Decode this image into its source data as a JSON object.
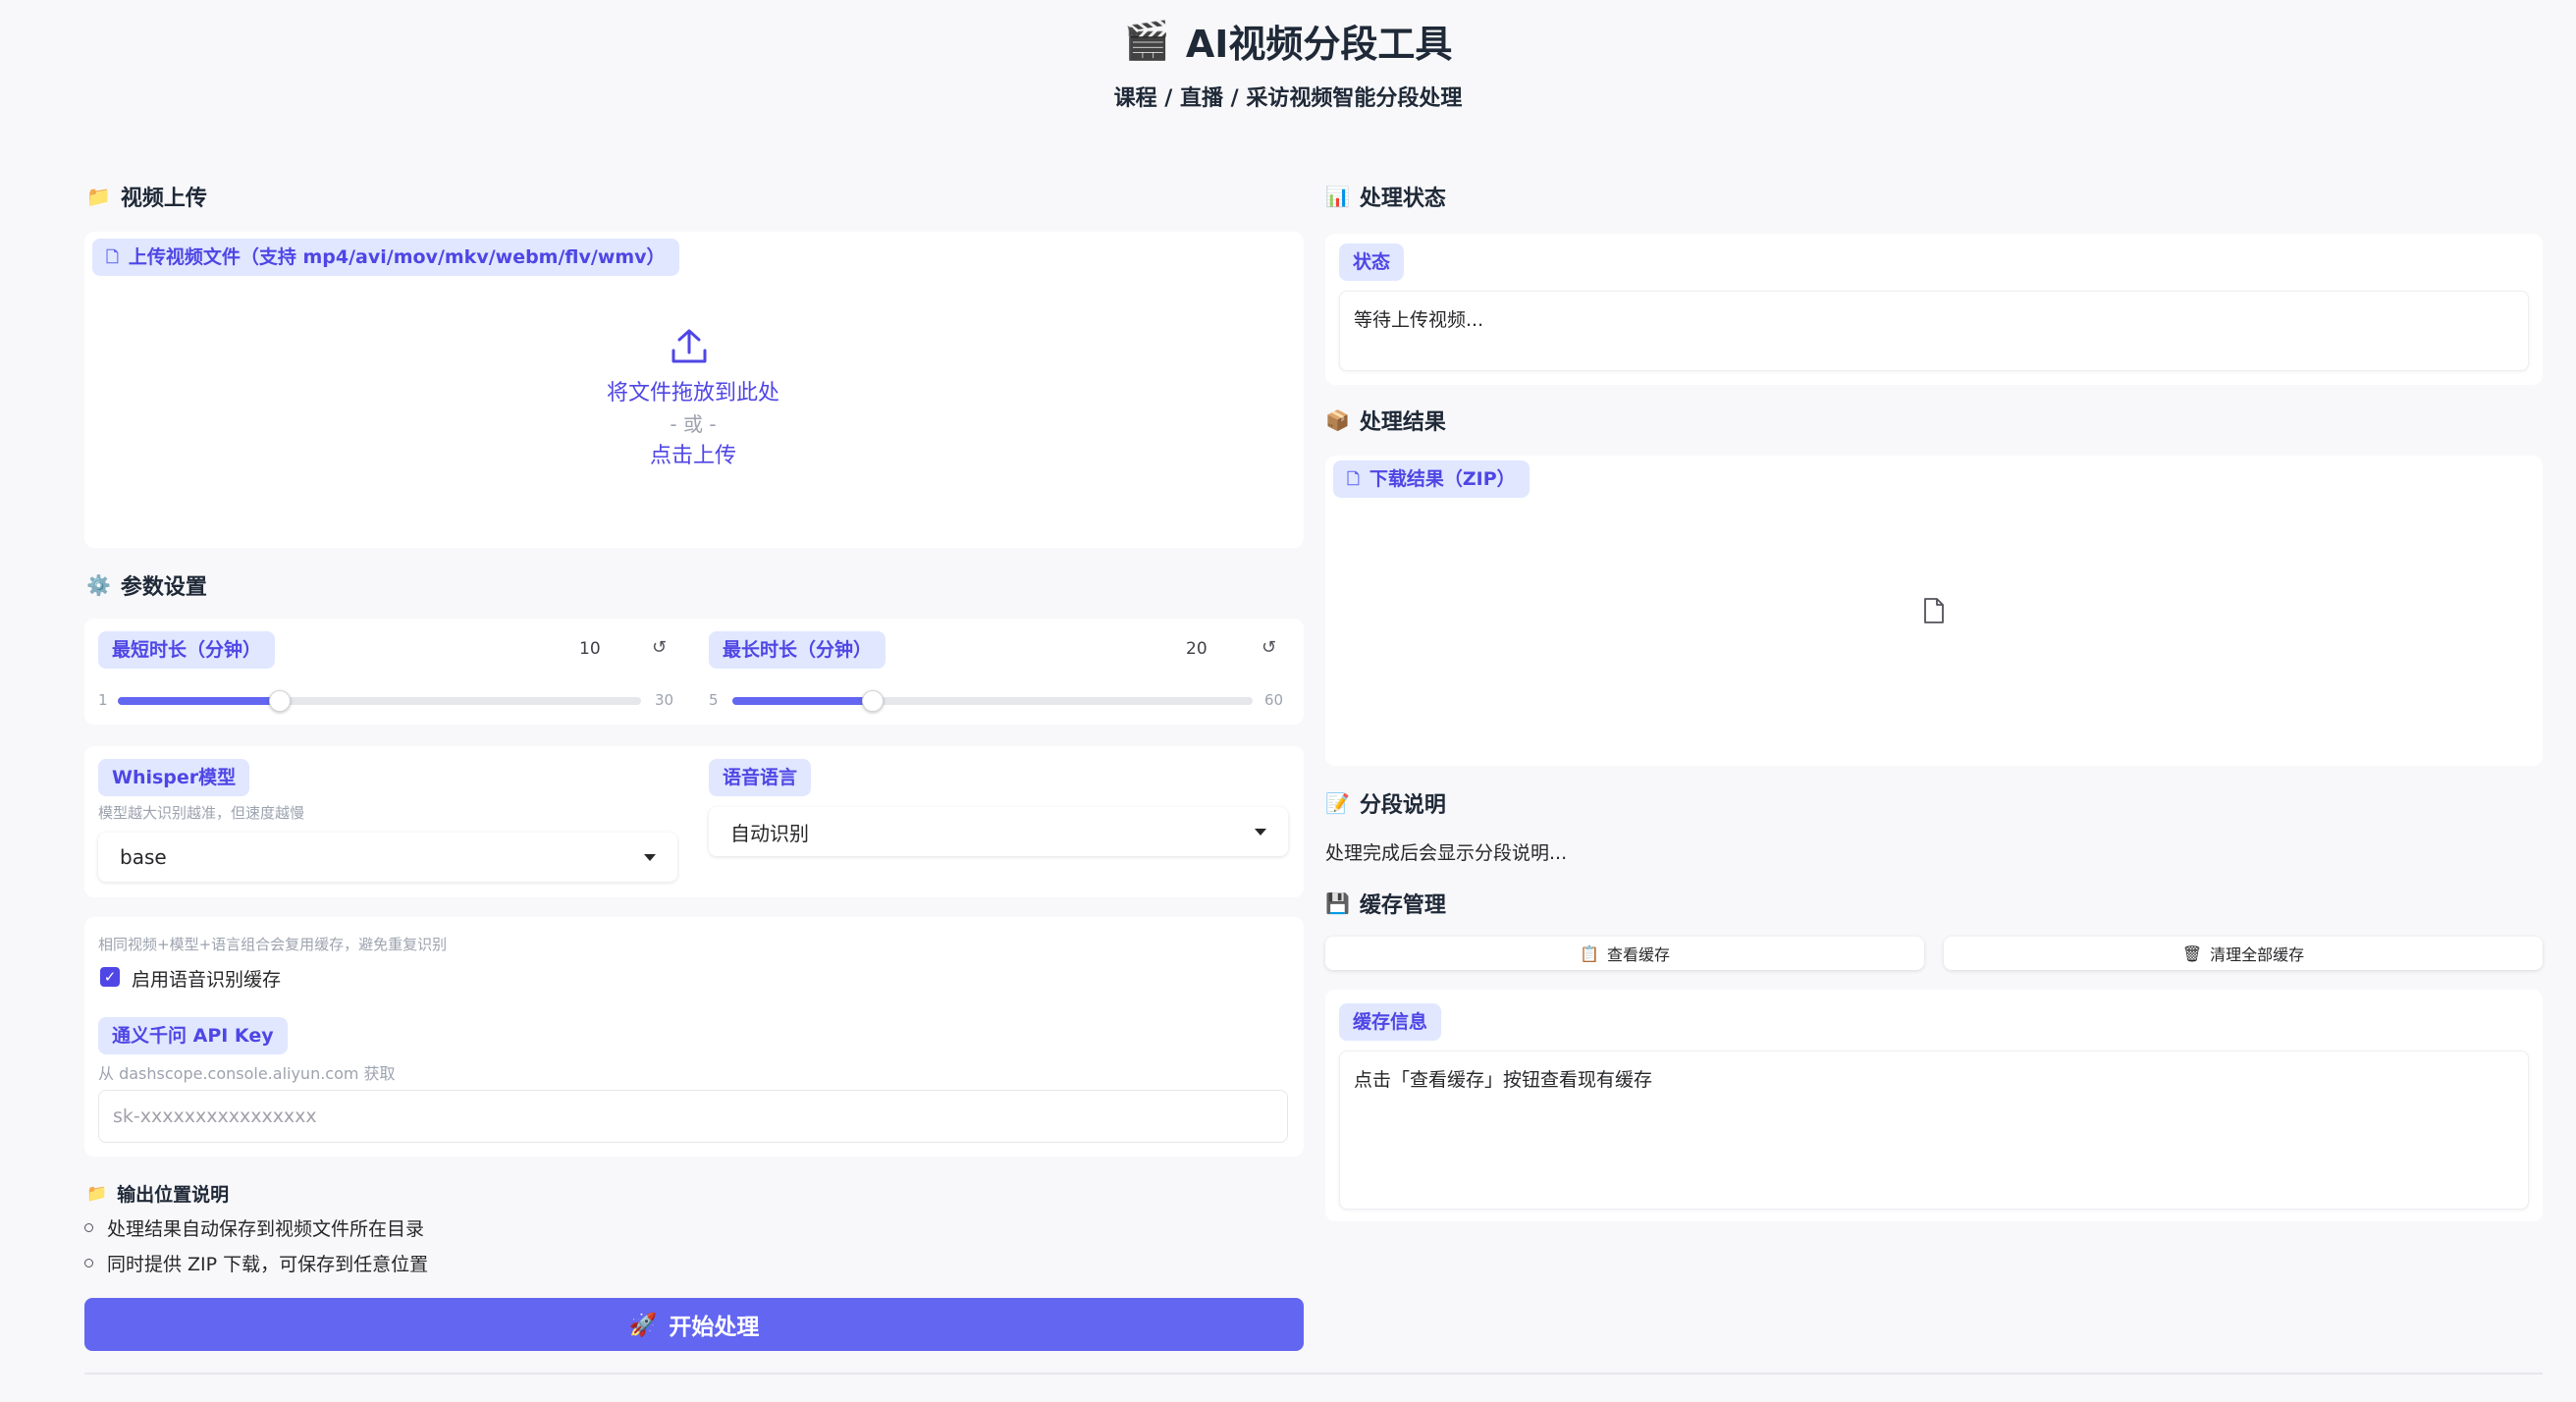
{
  "header": {
    "icon": "🎬",
    "title": "AI视频分段工具",
    "subtitle": "课程 / 直播 / 采访视频智能分段处理"
  },
  "upload": {
    "section_icon": "📁",
    "section_title": "视频上传",
    "chip_label": "上传视频文件（支持 mp4/avi/mov/mkv/webm/flv/wmv）",
    "drop_text": "将文件拖放到此处",
    "or_text": "- 或 -",
    "click_text": "点击上传"
  },
  "params": {
    "section_icon": "⚙️",
    "section_title": "参数设置",
    "min": {
      "label": "最短时长（分钟）",
      "value": "10",
      "range_min": "1",
      "range_max": "30",
      "fraction": 0.31
    },
    "max": {
      "label": "最长时长（分钟）",
      "value": "20",
      "range_min": "5",
      "range_max": "60",
      "fraction": 0.27
    },
    "reset_glyph": "↺",
    "whisper": {
      "label": "Whisper模型",
      "info": "模型越大识别越准，但速度越慢",
      "value": "base"
    },
    "language": {
      "label": "语音语言",
      "value": "自动识别"
    },
    "cache_info": "相同视频+模型+语言组合会复用缓存，避免重复识别",
    "cache_checkbox": "启用语音识别缓存",
    "api": {
      "label": "通义千问 API Key",
      "info": "从 dashscope.console.aliyun.com 获取",
      "placeholder": "sk-xxxxxxxxxxxxxxxx"
    }
  },
  "output": {
    "icon": "📁",
    "title": "输出位置说明",
    "items": [
      "处理结果自动保存到视频文件所在目录",
      "同时提供 ZIP 下载，可保存到任意位置"
    ]
  },
  "start_button": {
    "icon": "🚀",
    "label": "开始处理"
  },
  "status": {
    "section_icon": "📊",
    "section_title": "处理状态",
    "chip_label": "状态",
    "value": "等待上传视频..."
  },
  "result": {
    "section_icon": "📦",
    "section_title": "处理结果",
    "chip_label": "下载结果（ZIP）"
  },
  "segment": {
    "section_icon": "📝",
    "section_title": "分段说明",
    "text": "处理完成后会显示分段说明..."
  },
  "cache": {
    "section_icon": "💾",
    "section_title": "缓存管理",
    "view_icon": "📋",
    "view_label": "查看缓存",
    "clear_icon": "🗑",
    "clear_label": "清理全部缓存",
    "info_chip": "缓存信息",
    "info_text": "点击「查看缓存」按钮查看现有缓存"
  },
  "colors": {
    "accent": "#6366f1",
    "chip_bg": "#e0e7ff",
    "chip_text": "#4f46e5"
  }
}
